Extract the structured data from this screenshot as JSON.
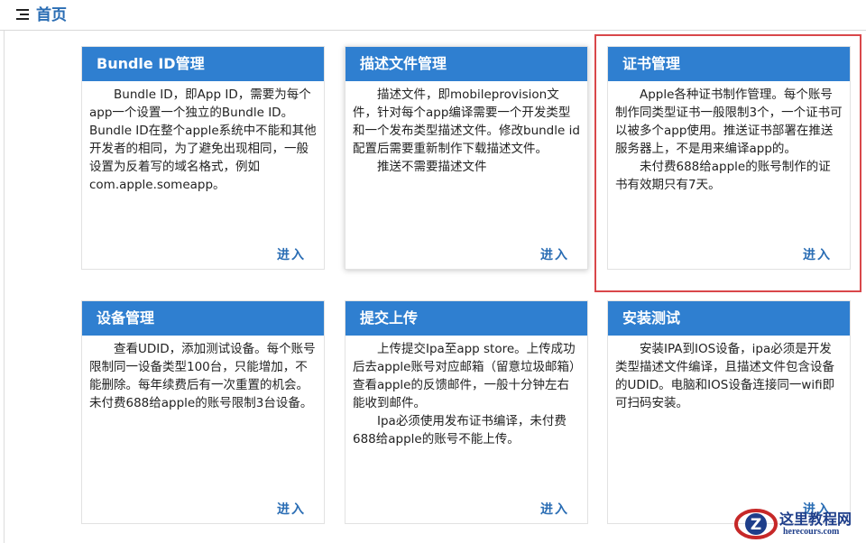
{
  "header": {
    "icon": "menu-icon",
    "title": "首页"
  },
  "cards": [
    {
      "title": "Bundle ID管理",
      "paragraphs": [
        "Bundle ID，即App ID，需要为每个app一个设置一个独立的Bundle ID。Bundle ID在整个apple系统中不能和其他开发者的相同，为了避免出现相同，一般设置为反着写的域名格式，例如com.apple.someapp。"
      ],
      "enter": "进入"
    },
    {
      "title": "描述文件管理",
      "paragraphs": [
        "描述文件，即mobileprovision文件，针对每个app编译需要一个开发类型和一个发布类型描述文件。修改bundle id配置后需要重新制作下载描述文件。",
        "推送不需要描述文件"
      ],
      "enter": "进入"
    },
    {
      "title": "证书管理",
      "paragraphs": [
        "Apple各种证书制作管理。每个账号制作同类型证书一般限制3个，一个证书可以被多个app使用。推送证书部署在推送服务器上，不是用来编译app的。",
        "未付费688给apple的账号制作的证书有效期只有7天。"
      ],
      "enter": "进入"
    },
    {
      "title": "设备管理",
      "paragraphs": [
        "查看UDID，添加测试设备。每个账号限制同一设备类型100台，只能增加，不能删除。每年续费后有一次重置的机会。未付费688给apple的账号限制3台设备。"
      ],
      "enter": "进入"
    },
    {
      "title": "提交上传",
      "paragraphs": [
        "上传提交Ipa至app store。上传成功后去apple账号对应邮箱（留意垃圾邮箱）查看apple的反馈邮件，一般十分钟左右能收到邮件。",
        "Ipa必须使用发布证书编译，未付费688给apple的账号不能上传。"
      ],
      "enter": "进入"
    },
    {
      "title": "安装测试",
      "paragraphs": [
        "安装IPA到IOS设备，ipa必须是开发类型描述文件编译，且描述文件包含设备的UDID。电脑和IOS设备连接同一wifi即可扫码安装。"
      ],
      "enter": "进入"
    }
  ],
  "watermark": {
    "name": "这里教程网",
    "url": "herecours.com",
    "logo": "z-logo-icon",
    "color": "#1e3e8a"
  },
  "colors": {
    "accent": "#2f7fd0",
    "link": "#2a6db4",
    "highlight": "#d9474a"
  }
}
